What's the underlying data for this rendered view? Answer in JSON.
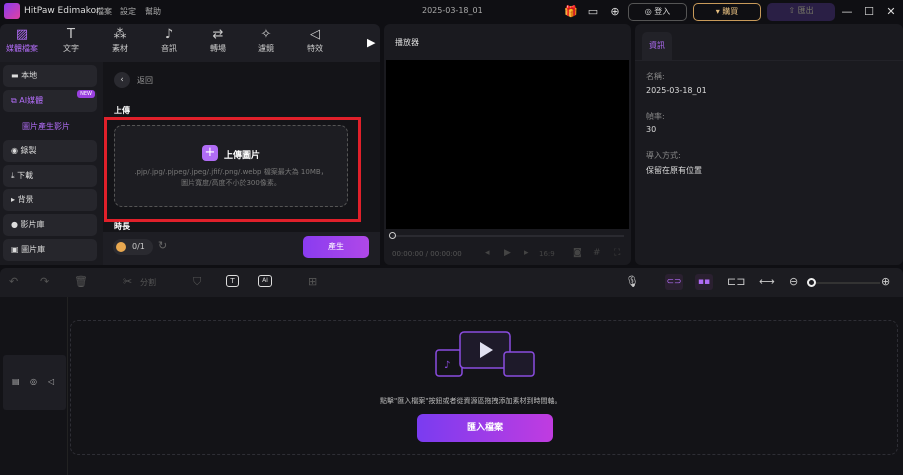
{
  "app": {
    "title": "HitPaw Edimakor",
    "menu": [
      "檔案",
      "設定",
      "幫助"
    ],
    "project_name": "2025-03-18_01",
    "buttons": {
      "login": "登入",
      "buy": "購買",
      "export": "匯出"
    }
  },
  "toolbar": {
    "items": [
      {
        "label": "媒體檔案",
        "icon": "media-icon",
        "active": true
      },
      {
        "label": "文字",
        "icon": "text-icon"
      },
      {
        "label": "素材",
        "icon": "elements-icon"
      },
      {
        "label": "音訊",
        "icon": "music-icon"
      },
      {
        "label": "轉場",
        "icon": "transition-icon"
      },
      {
        "label": "濾鏡",
        "icon": "filter-icon"
      },
      {
        "label": "特效",
        "icon": "effect-icon"
      }
    ]
  },
  "sidebar": {
    "items": [
      {
        "label": "本地",
        "icon": "folder-icon"
      },
      {
        "label": "AI媒體",
        "icon": "ai-media-icon",
        "badge": "NEW",
        "active": true
      },
      {
        "label": "圖片產生影片",
        "sub": true
      },
      {
        "label": "錄製",
        "icon": "record-icon"
      },
      {
        "label": "下載",
        "icon": "download-icon"
      },
      {
        "label": "背景",
        "icon": "play-icon"
      },
      {
        "label": "影片庫",
        "icon": "video-library-icon"
      },
      {
        "label": "圖片庫",
        "icon": "image-library-icon"
      }
    ]
  },
  "content": {
    "back": "返回",
    "upload_heading": "上傳",
    "upload_button": "上傳圖片",
    "upload_hint1": ".pjp/.jpg/.pjpeg/.jpeg/.jfif/.png/.webp 檔案最大為 10MB，",
    "upload_hint2": "圖片寬度/高度不小於300像素。",
    "duration_heading": "時長",
    "credits": "0/1",
    "generate": "產生"
  },
  "player": {
    "title": "播放器",
    "time": "00:00:00 / 00:00:00",
    "ratio": "16:9"
  },
  "info": {
    "tab": "資訊",
    "name_label": "名稱:",
    "name": "2025-03-18_01",
    "fps_label": "幀率:",
    "fps": "30",
    "import_label": "導入方式:",
    "import_value": "保留在原有位置"
  },
  "timeline": {
    "split": "分割",
    "hint": "點擊\"匯入檔案\"按鈕或者從資源區拖拽添加素材到時間軸。",
    "import_button": "匯入檔案"
  },
  "colors": {
    "accent": "#b06cf5",
    "highlight": "#e0202a"
  }
}
